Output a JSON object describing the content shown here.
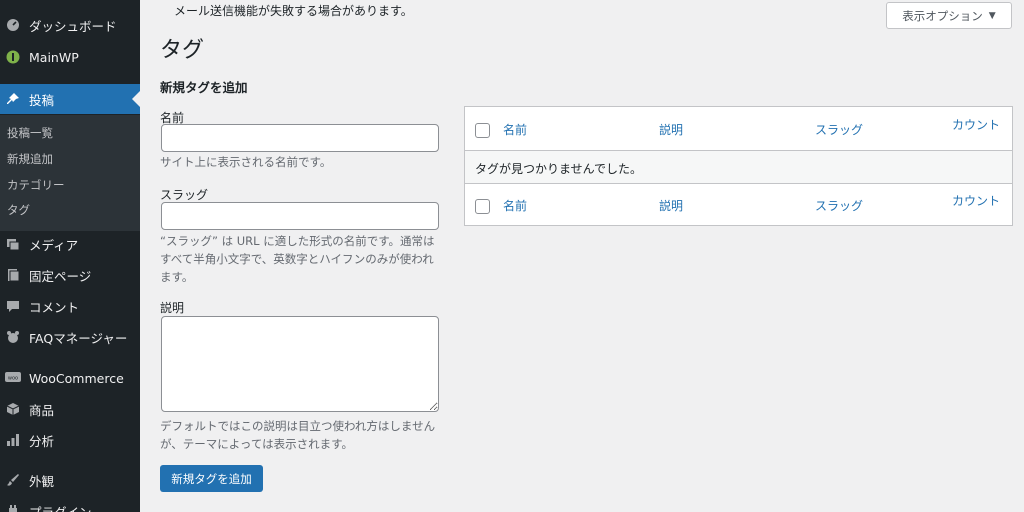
{
  "sidebar": {
    "items": [
      {
        "label": "ダッシュボード",
        "icon": "dashboard-icon"
      },
      {
        "label": "MainWP",
        "icon": "mainwp-icon"
      },
      {
        "label": "投稿",
        "icon": "pin-icon"
      },
      {
        "label": "メディア",
        "icon": "media-icon"
      },
      {
        "label": "固定ページ",
        "icon": "page-icon"
      },
      {
        "label": "コメント",
        "icon": "comment-icon"
      },
      {
        "label": "FAQマネージャー",
        "icon": "faq-icon"
      },
      {
        "label": "WooCommerce",
        "icon": "woocommerce-icon"
      },
      {
        "label": "商品",
        "icon": "product-icon"
      },
      {
        "label": "分析",
        "icon": "analytics-icon"
      },
      {
        "label": "外観",
        "icon": "appearance-icon"
      },
      {
        "label": "プラグイン",
        "icon": "plugin-icon"
      }
    ],
    "submenu": [
      "投稿一覧",
      "新規追加",
      "カテゴリー",
      "タグ"
    ]
  },
  "notice": "メール送信機能が失敗する場合があります。",
  "screen_options": "表示オプション",
  "page_title": "タグ",
  "form": {
    "section_title": "新規タグを追加",
    "name_label": "名前",
    "name_help": "サイト上に表示される名前です。",
    "slug_label": "スラッグ",
    "slug_help": "“スラッグ” は URL に適した形式の名前です。通常はすべて半角小文字で、英数字とハイフンのみが使われます。",
    "desc_label": "説明",
    "desc_help": "デフォルトではこの説明は目立つ使われ方はしませんが、テーマによっては表示されます。",
    "submit_label": "新規タグを追加"
  },
  "table": {
    "columns": [
      "名前",
      "説明",
      "スラッグ",
      "カウント"
    ],
    "empty_message": "タグが見つかりませんでした。"
  },
  "colors": {
    "accent": "#2271b1",
    "sidebar": "#1d2327"
  }
}
